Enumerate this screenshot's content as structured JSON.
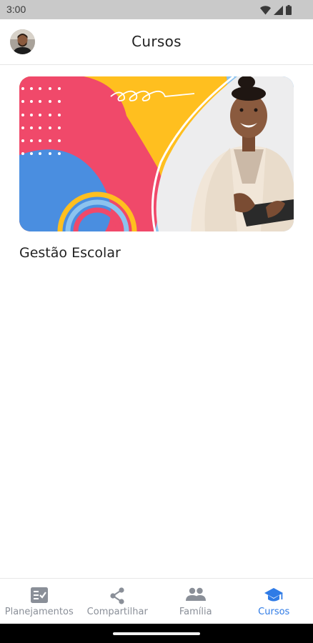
{
  "status_bar": {
    "time": "3:00",
    "icons": [
      "wifi-icon",
      "signal-icon",
      "battery-icon"
    ]
  },
  "header": {
    "title": "Cursos",
    "avatar": "user-avatar"
  },
  "courses": [
    {
      "title": "Gestão Escolar",
      "image": "course-banner-woman-with-tablet"
    }
  ],
  "bottom_nav": {
    "items": [
      {
        "label": "Planejamentos",
        "icon": "checklist-icon",
        "active": false
      },
      {
        "label": "Compartilhar",
        "icon": "share-icon",
        "active": false
      },
      {
        "label": "Família",
        "icon": "family-icon",
        "active": false
      },
      {
        "label": "Cursos",
        "icon": "graduation-cap-icon",
        "active": true
      }
    ]
  },
  "colors": {
    "accent": "#2f7be6",
    "inactive": "#8a8f98",
    "status_bar": "#c9c9c9"
  }
}
